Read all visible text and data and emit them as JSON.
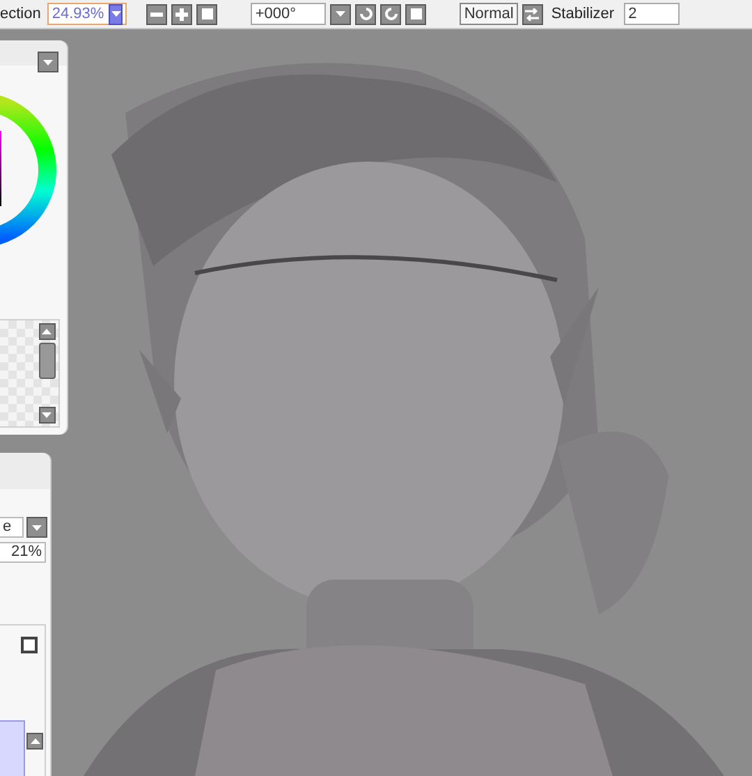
{
  "toolbar": {
    "zoom_label": "ection",
    "zoom": "24.93%",
    "angle": "+000°",
    "blend_mode": "Normal",
    "stabilizer_label": "Stabilizer",
    "stabilizer": "2"
  },
  "layer_panel": {
    "blend_mode": "e",
    "opacity": "21%",
    "layers": [
      {
        "selected": true
      }
    ]
  }
}
